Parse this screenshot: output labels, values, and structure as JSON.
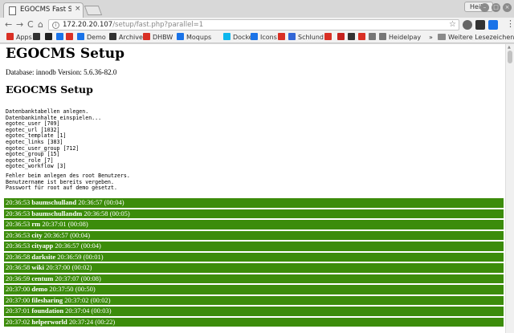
{
  "browser": {
    "tab_title": "EGOCMS Fast Setu",
    "tab_close": "×",
    "profile": "Heiko",
    "url_host": "172.20.20.107",
    "url_path": "/setup/fast.php?parallel=1",
    "nav": {
      "back": "←",
      "forward": "→",
      "reload": "C",
      "home": "⌂",
      "info": "i",
      "star": "☆",
      "menu": "⋮",
      "more": "»"
    },
    "window": {
      "minimize": "–",
      "maximize": "□",
      "close": "×"
    }
  },
  "bookmarks": [
    {
      "label": "Apps",
      "icon": "apps-grid-icon",
      "color": "#d93025"
    },
    {
      "label": "",
      "icon": "bookmark-square-icon",
      "color": "#333333"
    },
    {
      "label": "",
      "icon": "bookmark-p-icon",
      "color": "#222222"
    },
    {
      "label": "",
      "icon": "bookmark-chevron-icon",
      "color": "#1a73e8"
    },
    {
      "label": "",
      "icon": "bookmark-red-icon",
      "color": "#d93025"
    },
    {
      "label": "Demo",
      "icon": "demo-icon",
      "color": "#1a73e8"
    },
    {
      "label": "Archive",
      "icon": "archive-icon",
      "color": "#333333"
    },
    {
      "label": "DHBW",
      "icon": "dhbw-icon",
      "color": "#d93025"
    },
    {
      "label": "Moqups",
      "icon": "moqups-icon",
      "color": "#1a73e8"
    },
    {
      "label": "Docker",
      "icon": "docker-icon",
      "color": "#0db7ed"
    },
    {
      "label": "Icons",
      "icon": "icons-icon",
      "color": "#1a73e8"
    },
    {
      "label": "",
      "icon": "shield-icon",
      "color": "#d93025"
    },
    {
      "label": "Schlund",
      "icon": "schlund-icon",
      "color": "#3367d6"
    },
    {
      "label": "",
      "icon": "bookmark-b-icon",
      "color": "#d93025"
    },
    {
      "label": "",
      "icon": "bookmark-m-icon",
      "color": "#c5221f"
    },
    {
      "label": "",
      "icon": "bookmark-dark-icon",
      "color": "#333333"
    },
    {
      "label": "",
      "icon": "bookmark-z-icon",
      "color": "#d93025"
    },
    {
      "label": "",
      "icon": "bookmark-doc-icon",
      "color": "#777777"
    },
    {
      "label": "Heidelpay",
      "icon": "heidelpay-icon",
      "color": "#777777"
    },
    {
      "label": "Weitere Lesezeichen",
      "icon": "folder-icon",
      "color": "#888888"
    }
  ],
  "page": {
    "title": "EGOCMS Setup",
    "db_info": "Database: innodb Version: 5.6.36-82.0",
    "subtitle": "EGOCMS Setup",
    "log_lines": [
      "Datenbanktabellen anlegen.",
      "Datenbankinhalte einspielen...",
      "egotec_user [709]",
      "egotec_url [1032]",
      "egotec_template [1]",
      "egotec_links [383]",
      "egotec_user_group [712]",
      "egotec_group [15]",
      "egotec_role [7]",
      "egotec_workflow [3]"
    ],
    "error_lines": [
      "Fehler beim anlegen des root Benutzers.",
      "Benutzername ist bereits vergeben.",
      "Passwort für root auf demo gesetzt."
    ],
    "row_color": "#3c8c0b",
    "rows": [
      {
        "start": "20:36:53",
        "name": "baumschulland",
        "end": "20:36:57",
        "dur": "(00:04)"
      },
      {
        "start": "20:36:53",
        "name": "baumschullandm",
        "end": "20:36:58",
        "dur": "(00:05)"
      },
      {
        "start": "20:36:53",
        "name": "rm",
        "end": "20:37:01",
        "dur": "(00:08)"
      },
      {
        "start": "20:36:53",
        "name": "city",
        "end": "20:36:57",
        "dur": "(00:04)"
      },
      {
        "start": "20:36:53",
        "name": "cityapp",
        "end": "20:36:57",
        "dur": "(00:04)"
      },
      {
        "start": "20:36:58",
        "name": "darksite",
        "end": "20:36:59",
        "dur": "(00:01)"
      },
      {
        "start": "20:36:58",
        "name": "wiki",
        "end": "20:37:00",
        "dur": "(00:02)"
      },
      {
        "start": "20:36:59",
        "name": "centum",
        "end": "20:37:07",
        "dur": "(00:08)"
      },
      {
        "start": "20:37:00",
        "name": "demo",
        "end": "20:37:50",
        "dur": "(00:50)"
      },
      {
        "start": "20:37:00",
        "name": "filesharing",
        "end": "20:37:02",
        "dur": "(00:02)"
      },
      {
        "start": "20:37:01",
        "name": "foundation",
        "end": "20:37:04",
        "dur": "(00:03)"
      },
      {
        "start": "20:37:02",
        "name": "helperworld",
        "end": "20:37:24",
        "dur": "(00:22)"
      }
    ]
  }
}
